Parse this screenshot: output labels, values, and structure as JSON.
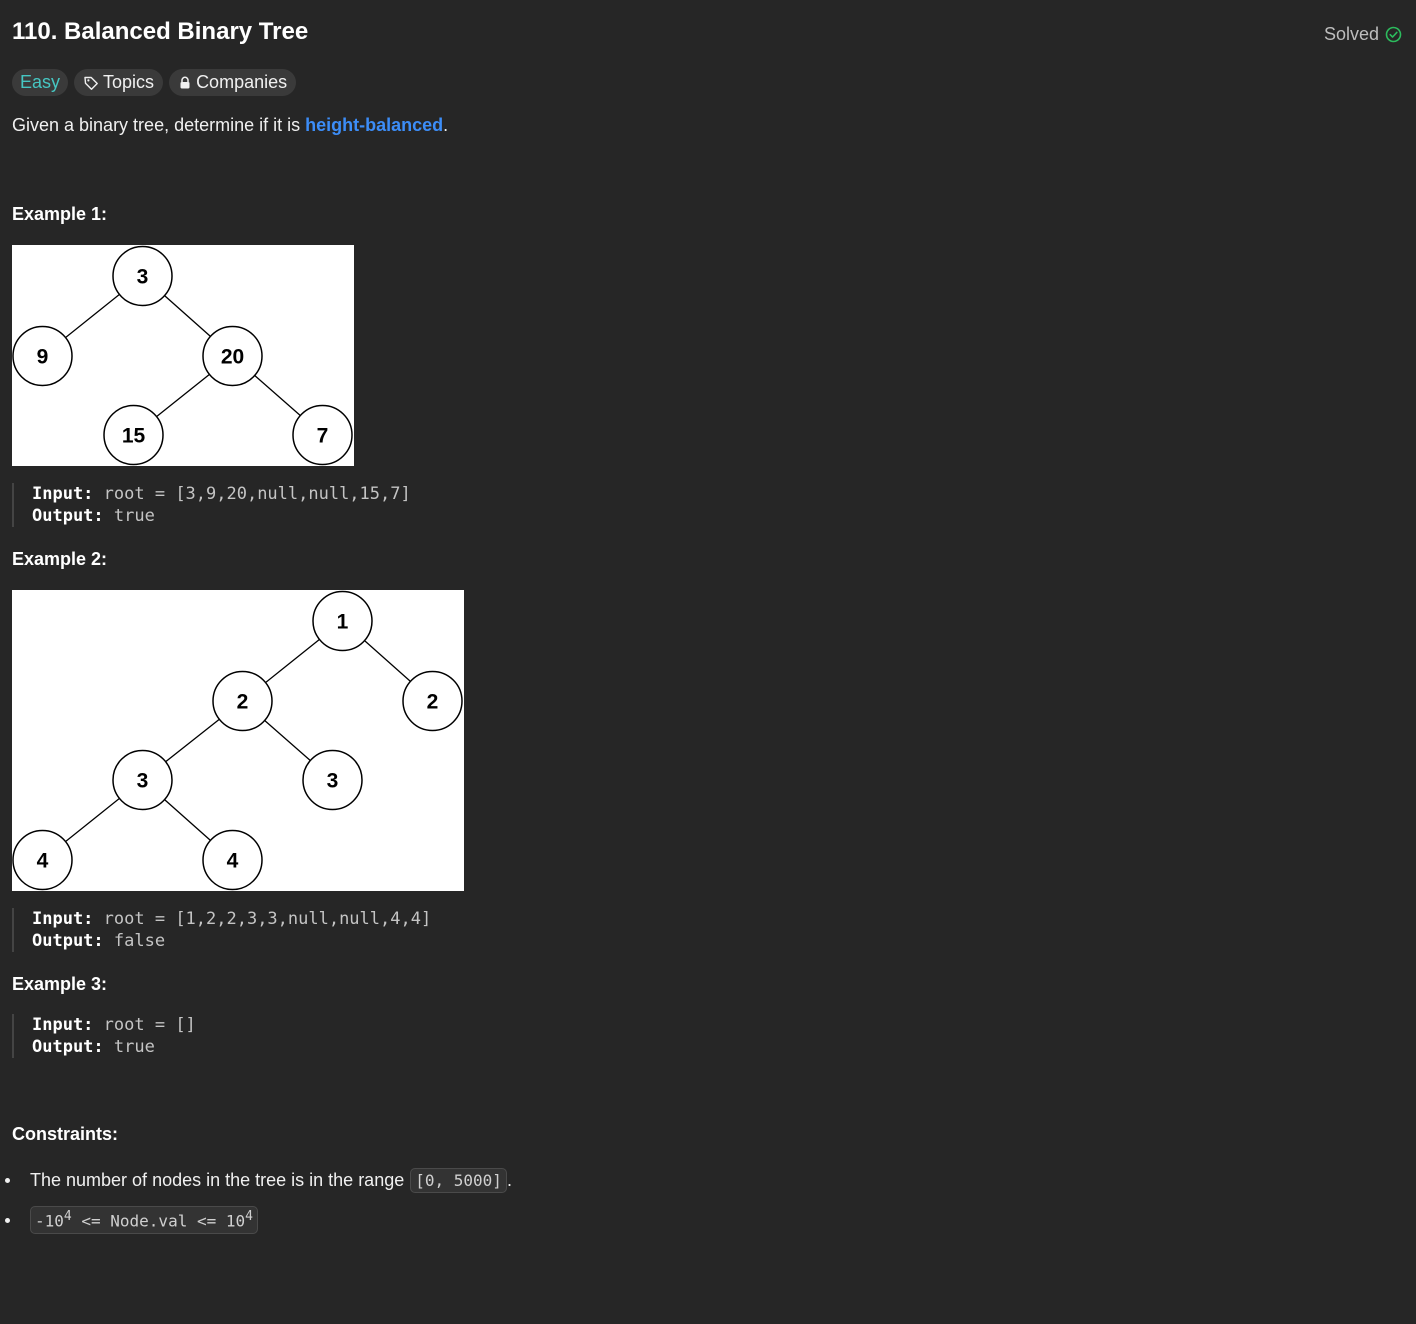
{
  "problem": {
    "title": "110. Balanced Binary Tree",
    "solved_label": "Solved",
    "difficulty": "Easy",
    "topics_label": "Topics",
    "companies_label": "Companies",
    "description_prefix": "Given a binary tree, determine if it is ",
    "description_link": "height-balanced",
    "description_suffix": "."
  },
  "examples": [
    {
      "heading": "Example 1:",
      "tree_nodes": [
        "3",
        "9",
        "20",
        "15",
        "7"
      ],
      "input_key": "Input:",
      "input_value": "root = [3,9,20,null,null,15,7]",
      "output_key": "Output:",
      "output_value": "true"
    },
    {
      "heading": "Example 2:",
      "tree_nodes": [
        "1",
        "2",
        "2",
        "3",
        "3",
        "4",
        "4"
      ],
      "input_key": "Input:",
      "input_value": "root = [1,2,2,3,3,null,null,4,4]",
      "output_key": "Output:",
      "output_value": "false"
    },
    {
      "heading": "Example 3:",
      "input_key": "Input:",
      "input_value": "root = []",
      "output_key": "Output:",
      "output_value": "true"
    }
  ],
  "constraints": {
    "heading": "Constraints:",
    "item1_text": "The number of nodes in the tree is in the range ",
    "item1_code": "[0, 5000]",
    "item1_suffix": ".",
    "item2_neg": "-10",
    "item2_exp1": "4",
    "item2_mid": " <= Node.val <= 10",
    "item2_exp2": "4"
  },
  "colors": {
    "background": "#262626",
    "easy": "#46c6c2",
    "link": "#3c8df7",
    "solved_check": "#2cbb5d"
  },
  "icons": {
    "solved": "check-circle-icon",
    "topics": "tag-icon",
    "companies": "lock-icon"
  }
}
